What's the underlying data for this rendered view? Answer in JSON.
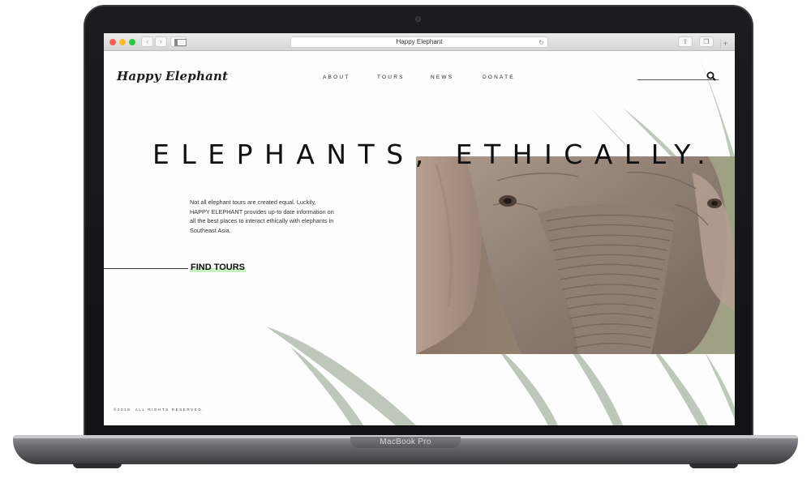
{
  "device": {
    "label": "MacBook Pro"
  },
  "browser": {
    "address_text": "Happy Elephant",
    "back_glyph": "‹",
    "forward_glyph": "›",
    "reload_glyph": "↻",
    "share_glyph": "⇪",
    "tabs_glyph": "❐",
    "new_tab_glyph": "+"
  },
  "site": {
    "logo": "Happy Elephant",
    "nav": [
      {
        "label": "ABOUT"
      },
      {
        "label": "TOURS"
      },
      {
        "label": "NEWS"
      },
      {
        "label": "DONATE"
      }
    ],
    "hero": {
      "headline": "ELEPHANTS, ETHICALLY.",
      "intro": "Not all elephant tours are created equal. Luckily, HAPPY ELEPHANT provides up-to date information on all the best places to interact ethically with elephants in Southeast Asia.",
      "cta": "FIND TOURS"
    },
    "footer": "©2018. ALL RIGHTS RESERVED."
  },
  "colors": {
    "accent_highlight": "#c9f2c3",
    "leaf_green": "#a9b5a2",
    "text_dark": "#111111"
  },
  "icons": {
    "search": "search-icon"
  }
}
